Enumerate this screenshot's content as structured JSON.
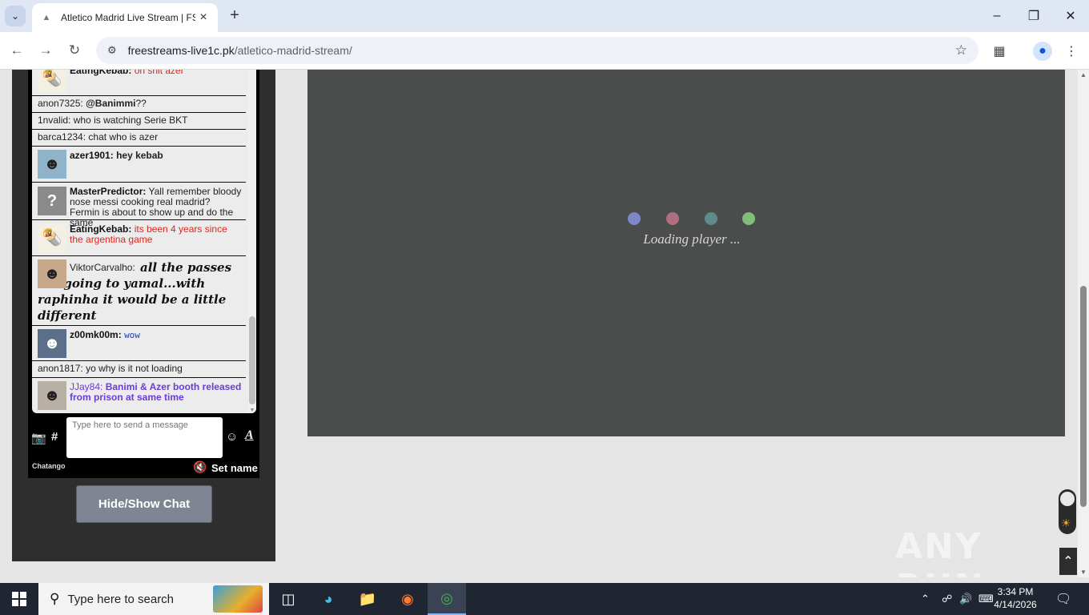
{
  "browser": {
    "tab_title": "Atletico Madrid Live Stream | FS",
    "url_host": "freestreams-live1c.pk",
    "url_path": "/atletico-madrid-stream/"
  },
  "chat": {
    "messages": [
      {
        "user": "EatingKebab:",
        "text": "oh shit azer"
      },
      {
        "user": "anon7325:",
        "mention": "@Banimmi",
        "text": "??"
      },
      {
        "user": "1nvalid:",
        "text": "who is watching Serie BKT"
      },
      {
        "user": "barca1234:",
        "text": "chat who is azer"
      },
      {
        "user": "azer1901:",
        "text": "hey kebab"
      },
      {
        "user": "MasterPredictor:",
        "text": "Yall remember bloody nose messi cooking real madrid? Fermin is about to show up and do the same"
      },
      {
        "user": "EatingKebab:",
        "text": "its been 4 years since the argentina game"
      },
      {
        "user": "ViktorCarvalho:",
        "text": "all the passes are going to yamal...with raphinha it would be a little different"
      },
      {
        "user": "z00mk00m:",
        "text": "wow"
      },
      {
        "user": "anon1817:",
        "text": "yo why is it not loading"
      },
      {
        "user": "JJay84:",
        "text": "Banimi & Azer booth released from prison at same time"
      }
    ],
    "input_placeholder": "Type here to send a message",
    "brand": "Chatango",
    "set_name": "Set name",
    "hash_label": "#",
    "format_label": "A"
  },
  "hide_show_label": "Hide/Show Chat",
  "player": {
    "loading_text": "Loading player ...",
    "dot_colors": [
      "#7f87c9",
      "#b06f80",
      "#5f8a8b",
      "#7fbf79"
    ]
  },
  "watermark": "ANY RUN",
  "taskbar": {
    "search_placeholder": "Type here to search",
    "time": "3:34 PM",
    "date": "4/14/2026"
  }
}
